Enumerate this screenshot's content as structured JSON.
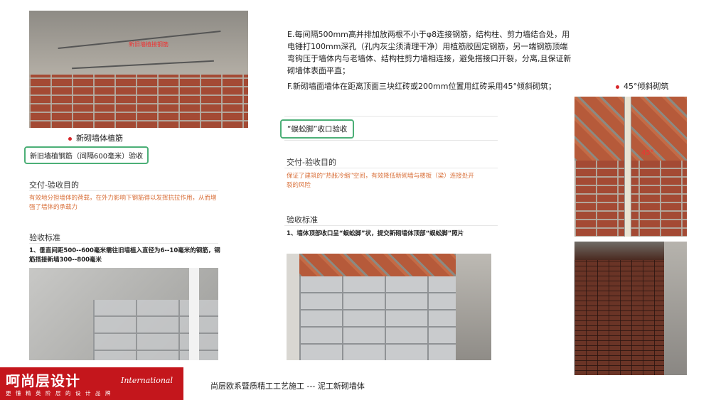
{
  "left_column": {
    "photo_caption": "新砌墙体植筋",
    "box_label": "新旧墙植钢筋（间隔600毫米）验收",
    "delivery_title": "交付-验收目的",
    "delivery_text": "有效地分担墙体的荷载，在外力影响下钢筋得以发挥抗拉作用，从而增强了墙体的承载力",
    "criteria_title": "验收标准",
    "criteria_text": "1、垂直间距500--600毫米需往旧墙植入直径为6--10毫米的钢筋，钢筋搭接新墙300--800毫米",
    "photo_overlay_text": "新旧墙植接钢筋"
  },
  "middle_column": {
    "paragraph_e": "E.每间隔500mm高并排加放两根不小于φ8连接钢筋，结构柱、剪力墙结合处，用电锤打100mm深孔（孔内灰尘须清理干净）用植筋胶固定钢筋，另一端钢筋顶端弯钩压于墙体内与老墙体、结构柱剪力墙相连接，避免搭接口开裂，分离,且保证新砌墙体表面平直；",
    "paragraph_f": "F.新砌墙面墙体在距离顶面三块红砖或200mm位置用红砖采用45°倾斜砌筑；",
    "box_label": "“蜈蚣脚”收口验收",
    "delivery_title": "交付-验收目的",
    "delivery_text": "保证了建筑的“热胀冷缩”空间，有效降低新砌墙与楼板（梁）连接处开裂的风险",
    "criteria_title": "验收标准",
    "criteria_text": "1、墙体顶部收口呈“蜈蚣脚”状，提交新砌墙体顶部“蜈蚣脚”照片"
  },
  "right_column": {
    "caption": "45°倾斜砌筑",
    "angle_label": "45°"
  },
  "footer": {
    "logo_main": "呵尚层设计",
    "logo_intl": "International",
    "logo_slogan": "更懂精英阶层的设计品牌",
    "title": "尚层欧系暨质精工工艺施工 ---   泥工新砌墙体"
  },
  "colors": {
    "accent_red": "#c4161c",
    "box_green": "#4caf77",
    "orange_text": "#d9703a"
  }
}
